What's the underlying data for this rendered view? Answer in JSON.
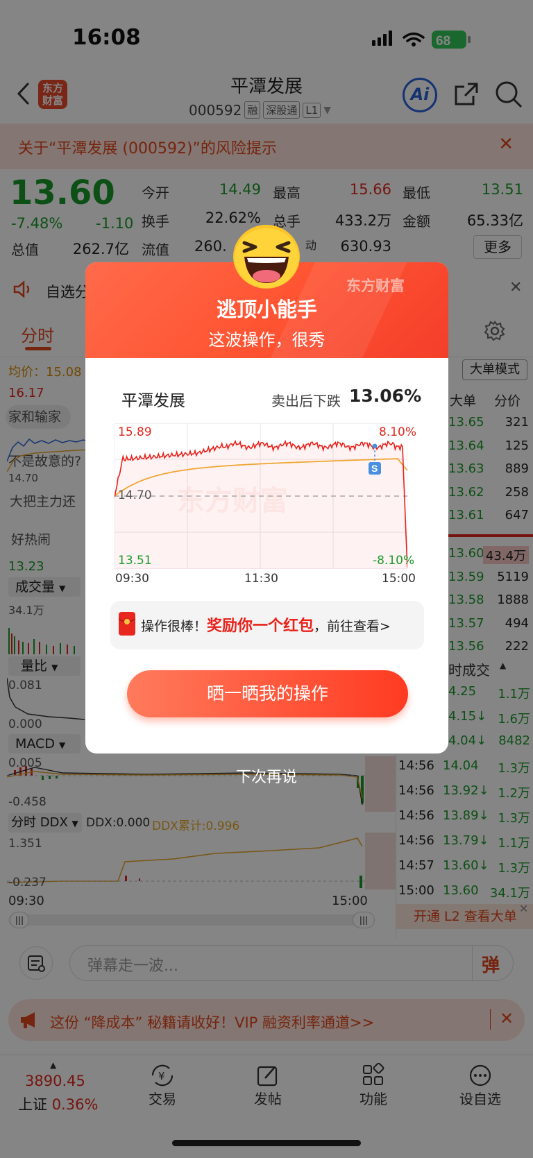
{
  "status": {
    "time": "16:08",
    "battery": "68"
  },
  "header": {
    "logo_line1": "东方",
    "logo_line2": "财富",
    "stock_name": "平潭发展",
    "stock_code": "000592",
    "tags": [
      "融",
      "深股通",
      "L1"
    ],
    "ai_label": "Ai"
  },
  "risk_notice": "关于“平潭发展 (000592)”的风险提示",
  "quote": {
    "price": "13.60",
    "pct": "-7.48%",
    "change": "-1.10",
    "open_label": "今开",
    "open": "14.49",
    "high_label": "最高",
    "high": "15.66",
    "low_label": "最低",
    "low": "13.51",
    "turnover_label": "换手",
    "turnover": "22.62%",
    "volume_label": "总手",
    "volume": "433.2万",
    "amount_label": "金额",
    "amount": "65.33亿",
    "mktcap_label": "总值",
    "mktcap": "262.7亿",
    "float_label": "流值",
    "float": "260.",
    "vol_label": "动",
    "vol_val": "630.93",
    "more": "更多"
  },
  "notice_row": {
    "text": "自选分"
  },
  "tabs": {
    "fenshi": "分时",
    "dadan_mode": "大单模式"
  },
  "left_chart": {
    "avg_label": "均价：15.08",
    "price_hi": "16.17",
    "price_lo": "13.23",
    "comment1": "家和输家",
    "comment2": "不是故意的?",
    "comment3": "大把主力还",
    "mid_price": "14.70",
    "hot": "好热闹",
    "vol_select": "成交量",
    "vol_max": "34.1万",
    "ratio_select": "量比",
    "ratio_max": "0.081",
    "ratio_min": "0.000",
    "macd_select": "MACD",
    "macd_top": "0.005",
    "macd_bot": "-0.458",
    "ddx_select": "分时 DDX",
    "ddx_val": "DDX:0.000",
    "ddx_cum": "DDX累计:0.996",
    "ddx_top": "1.351",
    "ddx_bot": "-0.237",
    "t_start": "09:30",
    "t_end": "15:00"
  },
  "orderbook": {
    "col_big": "大单",
    "col_split": "分价",
    "asks": [
      {
        "price": "13.65",
        "vol": "321"
      },
      {
        "price": "13.64",
        "vol": "125"
      },
      {
        "price": "13.63",
        "vol": "889"
      },
      {
        "price": "13.62",
        "vol": "258"
      },
      {
        "price": "13.61",
        "vol": "647"
      }
    ],
    "bids": [
      {
        "price": "13.60",
        "vol": "43.4万"
      },
      {
        "price": "13.59",
        "vol": "5119"
      },
      {
        "price": "13.58",
        "vol": "1888"
      },
      {
        "price": "13.57",
        "vol": "494"
      },
      {
        "price": "13.56",
        "vol": "222"
      }
    ],
    "trade_title": "时成交",
    "trades": [
      {
        "time": "",
        "price": "4.25",
        "vol": "1.1万"
      },
      {
        "time": "",
        "price": "4.15↓",
        "vol": "1.6万"
      },
      {
        "time": "",
        "price": "4.04↓",
        "vol": "8482"
      },
      {
        "time": "14:56",
        "price": "14.04",
        "vol": "1.3万"
      },
      {
        "time": "14:56",
        "price": "13.92↓",
        "vol": "1.2万"
      },
      {
        "time": "14:56",
        "price": "13.89↓",
        "vol": "1.3万"
      },
      {
        "time": "14:56",
        "price": "13.79↓",
        "vol": "1.1万"
      },
      {
        "time": "14:57",
        "price": "13.60↓",
        "vol": "1.3万"
      },
      {
        "time": "15:00",
        "price": "13.60",
        "vol": "34.1万"
      }
    ],
    "l2_promo": "开通 L2 查看大单"
  },
  "modal": {
    "brand": "东方财富",
    "title": "逃顶小能手",
    "subtitle": "这波操作，很秀",
    "stock_name": "平潭发展",
    "drop_label": "卖出后下跌",
    "drop_value": "13.06%",
    "chart": {
      "hi": "15.89",
      "hi_pct": "8.10%",
      "lo": "13.51",
      "lo_pct": "-8.10%",
      "mid": "14.70",
      "t1": "09:30",
      "t2": "11:30",
      "t3": "15:00",
      "sell_marker": "S",
      "watermark": "东方财富"
    },
    "redpack_text1": "操作很棒！",
    "redpack_text2": "奖励你一个红包",
    "redpack_text3": "，前往查看>",
    "share_button": "晒一晒我的操作",
    "later": "下次再说"
  },
  "danmu": {
    "placeholder": "弹幕走一波...",
    "btn": "弹"
  },
  "promo": {
    "text": "这份 “降成本” 秘籍请收好！VIP 融资利率通道>>"
  },
  "bottom_nav": {
    "index_val": "3890.45",
    "index_name": "上证",
    "index_pct": "0.36%",
    "trade": "交易",
    "post": "发帖",
    "func": "功能",
    "watch": "设自选"
  }
}
